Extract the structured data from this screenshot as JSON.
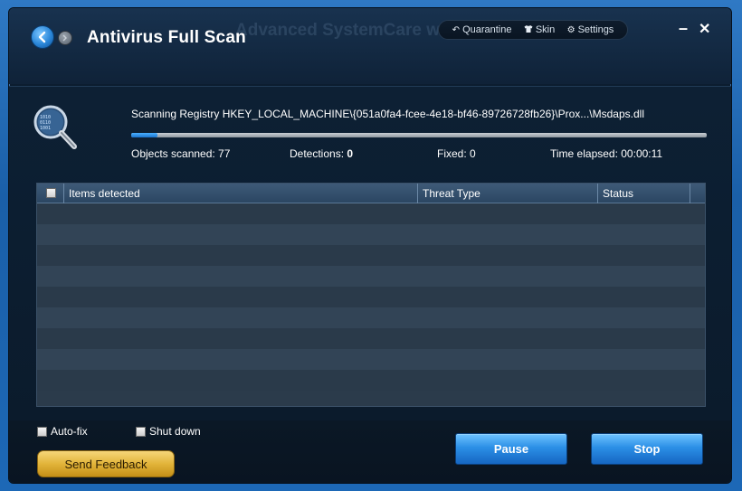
{
  "window": {
    "title": "Antivirus Full Scan",
    "ghost_title": "Advanced SystemCare with Antivirus"
  },
  "topmenu": {
    "quarantine": "Quarantine",
    "skin": "Skin",
    "settings": "Settings"
  },
  "window_controls": {
    "minimize": "–",
    "close": "✕"
  },
  "scan": {
    "path": "Scanning Registry HKEY_LOCAL_MACHINE\\{051a0fa4-fcee-4e18-bf46-89726728fb26}\\Prox...\\Msdaps.dll",
    "progress_fraction": 0.045,
    "objects_label": "Objects scanned: 77",
    "detections_label": "Detections:",
    "detections_value": "0",
    "fixed_label": "Fixed: 0",
    "time_label": "Time elapsed: 00:00:11"
  },
  "table": {
    "columns": [
      "Items detected",
      "Threat Type",
      "Status"
    ],
    "rows": []
  },
  "footer": {
    "autofix_label": "Auto-fix",
    "shutdown_label": "Shut down",
    "feedback_label": "Send Feedback",
    "pause_label": "Pause",
    "stop_label": "Stop"
  },
  "colors": {
    "accent_blue": "#2b8fe6",
    "gold": "#e2b43a",
    "window_bg": "#0b1b2c"
  },
  "icons": {
    "back": "back-arrow-icon",
    "forward": "forward-arrow-icon",
    "quarantine": "undo-arrow-icon",
    "skin": "tshirt-icon",
    "settings": "gear-icon",
    "scan": "magnifier-icon"
  }
}
